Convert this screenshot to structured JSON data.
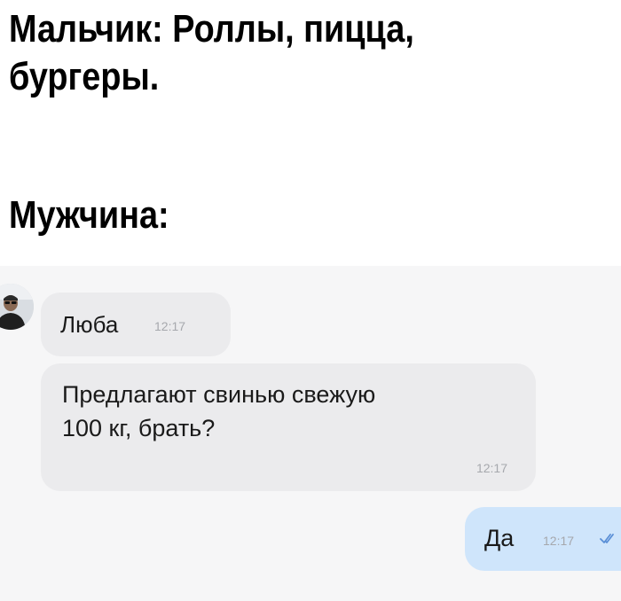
{
  "captions": {
    "line1": "Мальчик: Роллы, пицца,",
    "line2": "бургеры.",
    "line3": "Мужчина:"
  },
  "chat": {
    "messages": [
      {
        "text": "Люба",
        "time": "12:17"
      },
      {
        "line1": "Предлагают свинью свежую",
        "line2": "100 кг, брать?",
        "time": "12:17"
      },
      {
        "text": "Да",
        "time": "12:17",
        "status_icon": "double-check-icon"
      }
    ]
  },
  "colors": {
    "chat_bg": "#f6f6f7",
    "incoming_bubble": "#ebebed",
    "outgoing_bubble": "#cfe5fb",
    "read_check": "#5a8fd6"
  }
}
